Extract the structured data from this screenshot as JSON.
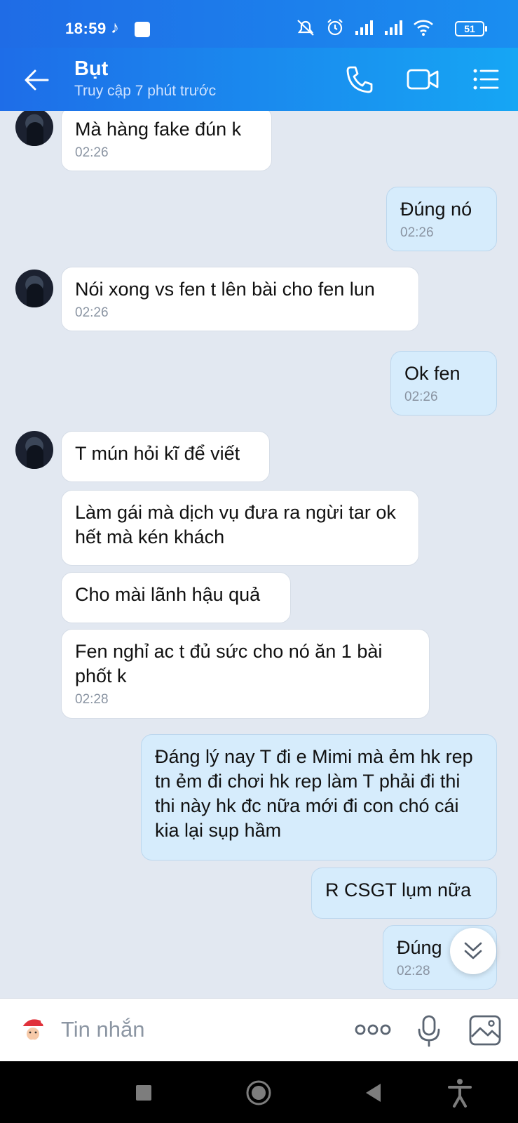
{
  "status_bar": {
    "time": "18:59",
    "battery": "51"
  },
  "header": {
    "contact_name": "Bụt",
    "last_seen": "Truy cập 7 phút trước"
  },
  "messages": [
    {
      "dir": "in",
      "text": "Mà hàng fake đún k",
      "time": "02:26",
      "avatar": true
    },
    {
      "dir": "out",
      "text": "Đúng nó",
      "time": "02:26"
    },
    {
      "dir": "in",
      "text": "Nói xong vs fen t lên bài cho fen lun",
      "time": "02:26",
      "avatar": true
    },
    {
      "dir": "out",
      "text": "Ok fen",
      "time": "02:26"
    },
    {
      "dir": "in",
      "text": "T mún hỏi kĩ để viết",
      "time": "",
      "avatar": true
    },
    {
      "dir": "in",
      "text": "Làm gái mà dịch vụ đưa ra ngừi tar ok hết mà kén khách",
      "time": ""
    },
    {
      "dir": "in",
      "text": "Cho mài lãnh hậu quả",
      "time": ""
    },
    {
      "dir": "in",
      "text": "Fen nghỉ ac t đủ sức cho nó ăn 1 bài phốt k",
      "time": "02:28"
    },
    {
      "dir": "out",
      "text": "Đáng lý nay T đi e Mimi mà ẻm hk rep tn ẻm đi chơi hk rep làm T phải đi thi thi này hk đc nữa mới đi con chó cái kia lại sụp hầm",
      "time": ""
    },
    {
      "dir": "out",
      "text": "R CSGT lụm nữa",
      "time": ""
    },
    {
      "dir": "out",
      "text": "Đúng",
      "time": "02:28"
    }
  ],
  "input": {
    "placeholder": "Tin nhắn"
  },
  "icons": {
    "back": "arrow-left-icon",
    "call": "phone-icon",
    "video": "video-camera-icon",
    "menu": "list-menu-icon",
    "scroll": "chevron-double-down-icon",
    "emoji": "santa-sticker-icon",
    "more": "more-dots-icon",
    "mic": "microphone-icon",
    "image": "image-icon"
  }
}
